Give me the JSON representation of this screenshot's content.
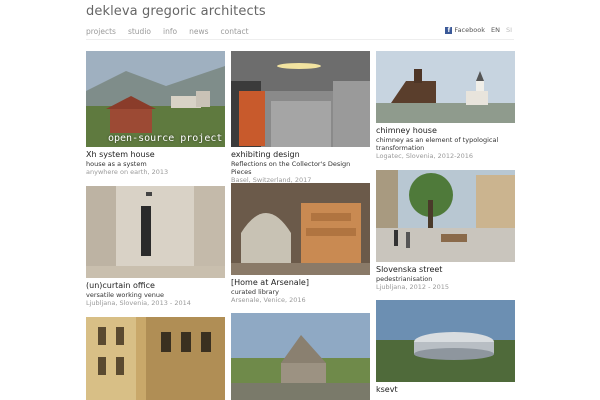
{
  "site": {
    "title": "dekleva gregoric architects"
  },
  "nav": [
    "projects",
    "studio",
    "info",
    "news",
    "contact"
  ],
  "social": {
    "facebook": "Facebook",
    "lang_en": "EN",
    "lang_si": "SI"
  },
  "projects": [
    {
      "title": "Xh system house",
      "subtitle": "house as a system",
      "meta": "anywhere on earth, 2013",
      "overlay": "open-source project"
    },
    {
      "title": "exhibiting design",
      "subtitle": "Reflections on the Collector's Design Pieces",
      "meta": "Basel, Switzerland, 2017"
    },
    {
      "title": "chimney house",
      "subtitle": "chimney as an element of typological transformation",
      "meta": "Logatec, Slovenia, 2012-2016"
    },
    {
      "title": "(un)curtain office",
      "subtitle": "versatile working venue",
      "meta": "Ljubljana, Slovenia, 2013 - 2014"
    },
    {
      "title": "[Home at Arsenale]",
      "subtitle": "curated library",
      "meta": "Arsenale, Venice, 2016"
    },
    {
      "title": "Slovenska street",
      "subtitle": "pedestrianisation",
      "meta": "Ljubljana, 2012 - 2015"
    },
    {
      "title": "",
      "subtitle": "",
      "meta": ""
    },
    {
      "title": "",
      "subtitle": "",
      "meta": ""
    },
    {
      "title": "ksevt",
      "subtitle": "",
      "meta": ""
    }
  ]
}
